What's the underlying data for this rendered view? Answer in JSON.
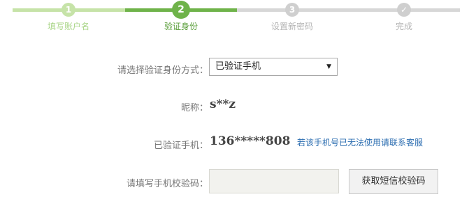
{
  "progress": {
    "steps": [
      {
        "number": "1",
        "label": "填写账户名",
        "status": "done"
      },
      {
        "number": "2",
        "label": "验证身份",
        "status": "current"
      },
      {
        "number": "3",
        "label": "设置新密码",
        "status": "pending"
      },
      {
        "number": "✓",
        "label": "完成",
        "status": "pending"
      }
    ]
  },
  "form": {
    "method_label": "请选择验证身份方式：",
    "method_value": "已验证手机",
    "nickname_label": "昵称：",
    "nickname_value": "s**z",
    "phone_label": "已验证手机：",
    "phone_value": "136*****808",
    "phone_help_link": "若该手机号已无法使用请联系客服",
    "code_label": "请填写手机校验码：",
    "code_value": "",
    "get_code_button": "获取短信校验码"
  },
  "colors": {
    "done": "#c6e3a8",
    "current": "#6fb34a",
    "pending": "#d7d7d7",
    "link": "#2a6cb0"
  }
}
